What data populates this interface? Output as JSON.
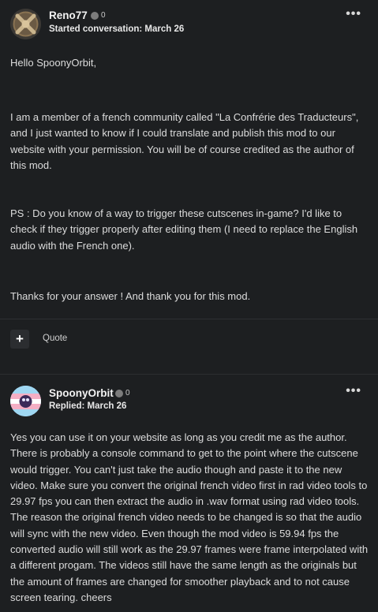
{
  "post1": {
    "author": "Reno77",
    "reputation": "0",
    "meta": "Started conversation: March 26",
    "paragraphs": [
      "Hello SpoonyOrbit,",
      "I am a member of a french community called \"La Confrérie des Traducteurs\", and I just wanted to know if I could translate and publish this mod to our website with your permission. You will be of course credited as the author of this mod.",
      "PS : Do you know of a way to trigger these cutscenes in-game? I'd like to check if they trigger properly after editing them (I need to replace the English audio with the French one).",
      "Thanks for your answer ! And thank you for this mod."
    ],
    "actions": {
      "add_icon": "+",
      "quote_label": "Quote"
    }
  },
  "post2": {
    "author": "SpoonyOrbit",
    "reputation": "0",
    "meta": "Replied: March 26",
    "paragraphs": [
      "Yes you can use it on your website as long as you credit me as the author. There is probably a console command to get to the point where the cutscene would trigger.  You can't just take the audio though and paste it to the new video.  Make sure you convert the original french video first in rad video tools to 29.97 fps you can then extract the audio in .wav format using rad video tools.  The reason the original french video needs to be changed is so that the audio will sync with the new video.  Even though the mod video is 59.94 fps the converted audio will still work as the 29.97 frames were frame interpolated with a different progam.  The videos still have the same length as the originals but the amount of frames are changed for smoother playback and to not cause screen tearing.  cheers"
    ]
  },
  "icons": {
    "more": "•••",
    "reputation_dot": "reputation-dot-icon"
  },
  "colors": {
    "background": "#1d1f21",
    "text": "#dcdcdc",
    "button_bg": "#2b2d30"
  }
}
